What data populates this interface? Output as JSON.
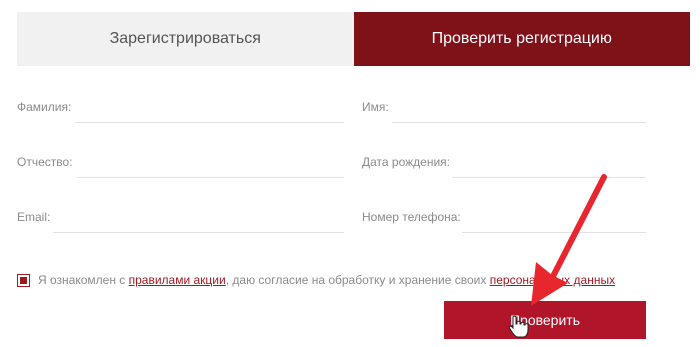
{
  "tabs": {
    "register_label": "Зарегистрироваться",
    "check_label": "Проверить регистрацию"
  },
  "form": {
    "last_name_label": "Фамилия:",
    "first_name_label": "Имя:",
    "patronymic_label": "Отчество:",
    "birth_date_label": "Дата рождения:",
    "email_label": "Email:",
    "phone_label": "Номер телефона:"
  },
  "agreement": {
    "prefix": "Я ознакомлен с ",
    "rules_link": "правилами акции",
    "middle": ", даю согласие на обработку и хранение своих ",
    "personal_link": "персональных данных",
    "checked": true
  },
  "submit_label": "Проверить",
  "colors": {
    "active_tab": "#7e1218",
    "button": "#b0152a",
    "arrow": "#e8262e"
  }
}
